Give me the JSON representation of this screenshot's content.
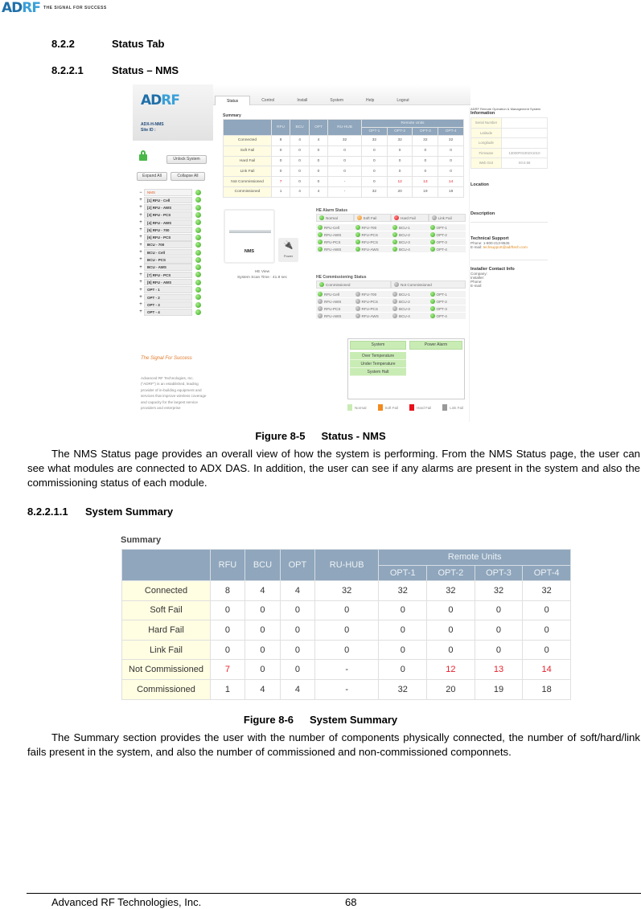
{
  "header": {
    "logo": "ADRF",
    "tagline": "THE SIGNAL FOR SUCCESS"
  },
  "headings": {
    "h1": {
      "num": "8.2.2",
      "title": "Status Tab"
    },
    "h2": {
      "num": "8.2.2.1",
      "title": "Status – NMS"
    },
    "h3": {
      "num": "8.2.2.1.1",
      "title": "System Summary"
    }
  },
  "figure1": {
    "caption_num": "Figure 8-5",
    "caption_title": "Status - NMS",
    "ui": {
      "logo": "ADRF",
      "model": "ADX-H-NMS",
      "site_id_label": "Site ID :",
      "unlock_button": "Unlock System",
      "expand_all": "Expand All",
      "collapse_all": "Collapse All",
      "tabs": [
        "Status",
        "Control",
        "Install",
        "System",
        "Help",
        "Logout"
      ],
      "active_tab": "Status",
      "tree": [
        {
          "sign": "−",
          "label": "NMS",
          "status": "normal"
        },
        {
          "sign": "+",
          "label": "[1] RFU - Cell",
          "status": "normal"
        },
        {
          "sign": "+",
          "label": "[2] RFU - AWS",
          "status": "normal"
        },
        {
          "sign": "+",
          "label": "[3] RFU - PCS",
          "status": "normal"
        },
        {
          "sign": "+",
          "label": "[4] RFU - AWS",
          "status": "normal"
        },
        {
          "sign": "+",
          "label": "[5] RFU - 700",
          "status": "normal"
        },
        {
          "sign": "+",
          "label": "[6] RFU - PCS",
          "status": "normal"
        },
        {
          "sign": "+",
          "label": "BCU - 700",
          "status": "normal"
        },
        {
          "sign": "+",
          "label": "BCU - Cell",
          "status": "normal"
        },
        {
          "sign": "+",
          "label": "BCU - PCS",
          "status": "normal"
        },
        {
          "sign": "+",
          "label": "BCU - AWS",
          "status": "normal"
        },
        {
          "sign": "+",
          "label": "[7] RFU - PCS",
          "status": "normal"
        },
        {
          "sign": "+",
          "label": "[8] RFU - AWS",
          "status": "normal"
        },
        {
          "sign": "+",
          "label": "OPT - 1",
          "status": "normal"
        },
        {
          "sign": "+",
          "label": "OPT - 2",
          "status": "normal"
        },
        {
          "sign": "+",
          "label": "OPT - 3",
          "status": "normal"
        },
        {
          "sign": "+",
          "label": "OPT - 4",
          "status": "normal"
        }
      ],
      "side_tagline": "The Signal For Success",
      "side_about": "Advanced RF Technologies, Inc. (\"ADRF\") is an established, leading provider of in-building equipment and services that improve wireless coverage and capacity for the largest service providers and enterprise",
      "he_view": {
        "name": "NMS",
        "power_label": "Power",
        "caption": "HE View",
        "scan_time": "System Scan Time : 41.8 sec"
      },
      "alarm_status": {
        "title": "HE Alarm Status",
        "legend": [
          {
            "label": "Normal",
            "color": "g"
          },
          {
            "label": "Soft Fail",
            "color": "o"
          },
          {
            "label": "Hard Fail",
            "color": "r"
          },
          {
            "label": "Link Fail",
            "color": "k"
          }
        ],
        "rows": [
          [
            {
              "label": "RFU-Cell",
              "color": "g"
            },
            {
              "label": "RFU-700",
              "color": "g"
            },
            {
              "label": "BCU-1",
              "color": "g"
            },
            {
              "label": "OPT-1",
              "color": "g"
            }
          ],
          [
            {
              "label": "RFU-AWS",
              "color": "g"
            },
            {
              "label": "RFU-PCS",
              "color": "g"
            },
            {
              "label": "BCU-2",
              "color": "g"
            },
            {
              "label": "OPT-2",
              "color": "g"
            }
          ],
          [
            {
              "label": "RFU-PCS",
              "color": "g"
            },
            {
              "label": "RFU-PCS",
              "color": "g"
            },
            {
              "label": "BCU-3",
              "color": "g"
            },
            {
              "label": "OPT-3",
              "color": "g"
            }
          ],
          [
            {
              "label": "RFU-AWS",
              "color": "g"
            },
            {
              "label": "RFU-AWS",
              "color": "g"
            },
            {
              "label": "BCU-4",
              "color": "g"
            },
            {
              "label": "OPT-4",
              "color": "g"
            }
          ]
        ]
      },
      "commissioning_status": {
        "title": "HE Commissioning Status",
        "legend": [
          {
            "label": "Commissioned",
            "color": "g"
          },
          {
            "label": "Not Commissioned",
            "color": "k"
          }
        ],
        "rows": [
          [
            {
              "label": "RFU-Cell",
              "color": "g"
            },
            {
              "label": "RFU-700",
              "color": "k"
            },
            {
              "label": "BCU-1",
              "color": "k"
            },
            {
              "label": "OPT-1",
              "color": "g"
            }
          ],
          [
            {
              "label": "RFU-AWS",
              "color": "k"
            },
            {
              "label": "RFU-PCS",
              "color": "k"
            },
            {
              "label": "BCU-2",
              "color": "k"
            },
            {
              "label": "OPT-2",
              "color": "g"
            }
          ],
          [
            {
              "label": "RFU-PCS",
              "color": "k"
            },
            {
              "label": "RFU-PCS",
              "color": "k"
            },
            {
              "label": "BCU-3",
              "color": "k"
            },
            {
              "label": "OPT-3",
              "color": "g"
            }
          ],
          [
            {
              "label": "RFU-AWS",
              "color": "k"
            },
            {
              "label": "RFU-AWS",
              "color": "k"
            },
            {
              "label": "BCU-4",
              "color": "k"
            },
            {
              "label": "OPT-4",
              "color": "g"
            }
          ]
        ]
      },
      "system_alarms": {
        "tabs": [
          "System",
          "Power Alarm"
        ],
        "items": [
          "Over Temperature",
          "Under Temperature",
          "System Halt"
        ],
        "legend": [
          {
            "label": "Normal",
            "color": "#c9ecb5"
          },
          {
            "label": "Soft Fail",
            "color": "#f28a1e"
          },
          {
            "label": "Hard Fail",
            "color": "#e8101a"
          },
          {
            "label": "Link Fail",
            "color": "#999999"
          }
        ]
      },
      "info": {
        "system_name": "ADRF Remote Operation & Management System",
        "title": "Information",
        "rows": [
          {
            "key": "Serial Number",
            "value": ""
          },
          {
            "key": "Latitude",
            "value": ""
          },
          {
            "key": "Longitude",
            "value": ""
          },
          {
            "key": "Firmware",
            "value": "13000F01002X1010"
          },
          {
            "key": "Web GUI",
            "value": "X0.0.58"
          }
        ],
        "location_title": "Location",
        "description_title": "Description",
        "support_title": "Technical Support",
        "support_phone": "Phone: 1-800-213-9545",
        "support_email_label": "E-mail: ",
        "support_email": "techsupport@adrftech.com",
        "installer_title": "Installer Contact Info",
        "installer_fields": [
          "Company:",
          "Installer:",
          "Phone:",
          "E-mail:"
        ]
      }
    }
  },
  "summary": {
    "title": "Summary",
    "group_header": "Remote Units",
    "columns": [
      "RFU",
      "BCU",
      "OPT",
      "RU-HUB"
    ],
    "remote_columns": [
      "OPT-1",
      "OPT-2",
      "OPT-3",
      "OPT-4"
    ],
    "rows": [
      {
        "label": "Connected",
        "values": [
          "8",
          "4",
          "4",
          "32",
          "32",
          "32",
          "32",
          "32"
        ],
        "red": []
      },
      {
        "label": "Soft Fail",
        "values": [
          "0",
          "0",
          "0",
          "0",
          "0",
          "0",
          "0",
          "0"
        ],
        "red": []
      },
      {
        "label": "Hard Fail",
        "values": [
          "0",
          "0",
          "0",
          "0",
          "0",
          "0",
          "0",
          "0"
        ],
        "red": []
      },
      {
        "label": "Link Fail",
        "values": [
          "0",
          "0",
          "0",
          "0",
          "0",
          "0",
          "0",
          "0"
        ],
        "red": []
      },
      {
        "label": "Not Commissioned",
        "values": [
          "7",
          "0",
          "0",
          "-",
          "0",
          "12",
          "13",
          "14"
        ],
        "red": [
          0,
          5,
          6,
          7
        ]
      },
      {
        "label": "Commissioned",
        "values": [
          "1",
          "4",
          "4",
          "-",
          "32",
          "20",
          "19",
          "18"
        ],
        "red": []
      }
    ]
  },
  "body": {
    "para1": "The NMS Status page provides an overall view of how the system is performing.  From the NMS Status page, the user can see what modules are connected to ADX DAS.  In addition, the user can see if any alarms are present in the system and also the commissioning status of each module.",
    "para2": "The Summary section provides the user with the number of components physically connected, the number of soft/hard/link fails present in the system, and also the number of commissioned and non-commissioned componnets."
  },
  "figure2": {
    "caption_num": "Figure 8-6",
    "caption_title": "System Summary"
  },
  "footer": {
    "company": "Advanced RF Technologies, Inc.",
    "page": "68"
  }
}
